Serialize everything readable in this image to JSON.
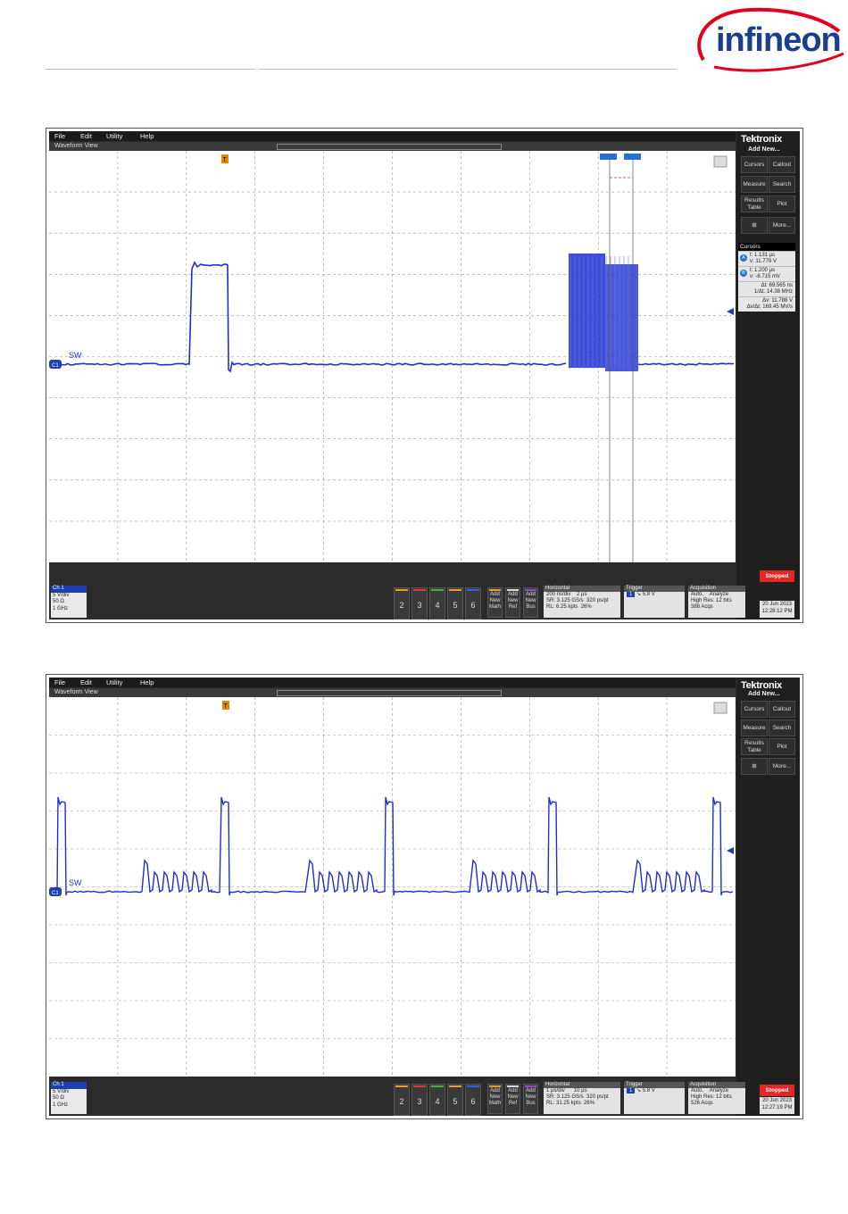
{
  "logo": {
    "text": "infineon",
    "color": "#e2001a",
    "text_color": "#1a3f8e"
  },
  "scopes": [
    {
      "menu": [
        "File",
        "Edit",
        "Utility",
        "Help"
      ],
      "view_title": "Waveform View",
      "brand": "Tektronix",
      "add_new": "Add New...",
      "side_buttons": [
        "Cursors",
        "Callout",
        "Measure",
        "Search",
        "Results Table",
        "Plot",
        "More..."
      ],
      "cursors": {
        "title": "Cursors",
        "a_label": "A",
        "a_t": "t: 1.131 µs",
        "a_v": "v: 11.779 V",
        "b_label": "B",
        "b_t": "t: 1.200 µs",
        "b_v": "v: -8.715 mV",
        "dt": "Δt: 69.565 ns",
        "inv_dt": "1/Δt: 14.38 MHz",
        "dv": "Δv: 11.788 V",
        "dvdt": "Δv/Δt: 169.45 MV/s"
      },
      "trace_label": "SW",
      "channel_marker": "C1",
      "trigger_marker": "T",
      "ch1": {
        "title": "Ch 1",
        "scale": "5 V/div",
        "imp": "50 Ω",
        "bw": "1 GHz"
      },
      "channels": [
        "2",
        "3",
        "4",
        "5",
        "6"
      ],
      "add_buttons": [
        "Add New Math",
        "Add New Ref",
        "Add New Bus"
      ],
      "horizontal": {
        "title": "Horizontal",
        "r1a": "200 ns/div",
        "r1b": "2 µs",
        "r2a": "SR: 3.125 GS/s",
        "r2b": "320 ps/pt",
        "r3a": "RL: 6.25 kpts",
        "r3b": "26%"
      },
      "trigger": {
        "title": "Trigger",
        "ch": "1",
        "level": "5.8 V"
      },
      "acquisition": {
        "title": "Acquisition",
        "r1a": "Auto,",
        "r1b": "Analyze",
        "r2": "High Res: 12 bits",
        "r3": "388 Acqs"
      },
      "status": "Stopped",
      "date": "20 Jun 2023",
      "time": "12:28:12 PM"
    },
    {
      "menu": [
        "File",
        "Edit",
        "Utility",
        "Help"
      ],
      "view_title": "Waveform View",
      "brand": "Tektronix",
      "add_new": "Add New...",
      "side_buttons": [
        "Cursors",
        "Callout",
        "Measure",
        "Search",
        "Results Table",
        "Plot",
        "More..."
      ],
      "trace_label": "SW",
      "channel_marker": "C1",
      "trigger_marker": "T",
      "ch1": {
        "title": "Ch 1",
        "scale": "5 V/div",
        "imp": "50 Ω",
        "bw": "1 GHz"
      },
      "channels": [
        "2",
        "3",
        "4",
        "5",
        "6"
      ],
      "add_buttons": [
        "Add New Math",
        "Add New Ref",
        "Add New Bus"
      ],
      "horizontal": {
        "title": "Horizontal",
        "r1a": "1 µs/div",
        "r1b": "10 µs",
        "r2a": "SR: 3.125 GS/s",
        "r2b": "320 ps/pt",
        "r3a": "RL: 31.25 kpts",
        "r3b": "26%"
      },
      "trigger": {
        "title": "Trigger",
        "ch": "1",
        "level": "5.8 V"
      },
      "acquisition": {
        "title": "Acquisition",
        "r1a": "Auto,",
        "r1b": "Analyze",
        "r2": "High Res: 12 bits",
        "r3": "526 Acqs"
      },
      "status": "Stopped",
      "date": "20 Jun 2023",
      "time": "12:27:19 PM"
    }
  ],
  "colors": {
    "trace": "#1f2fd0",
    "grid": "#9a9a9a",
    "stopped": "#e32626",
    "cursor_line": "#556"
  }
}
